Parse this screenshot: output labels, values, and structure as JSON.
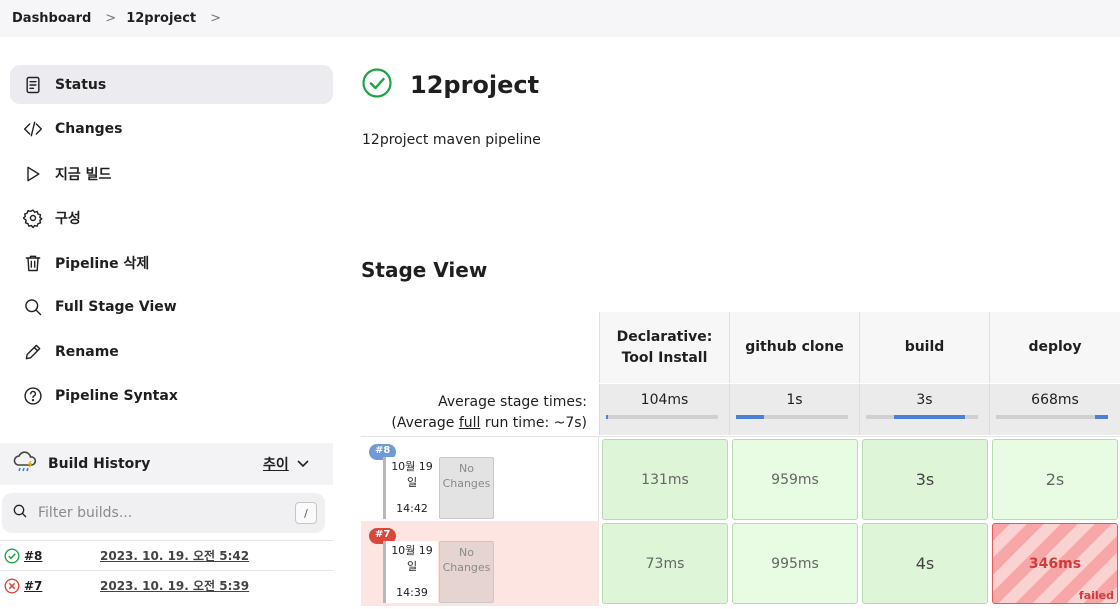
{
  "breadcrumb": {
    "items": [
      "Dashboard",
      "12project"
    ]
  },
  "sidebar": {
    "tasks": [
      {
        "label": "Status",
        "icon": "document-icon"
      },
      {
        "label": "Changes",
        "icon": "code-icon"
      },
      {
        "label": "지금 빌드",
        "icon": "play-icon"
      },
      {
        "label": "구성",
        "icon": "gear-icon"
      },
      {
        "label": "Pipeline 삭제",
        "icon": "trash-icon"
      },
      {
        "label": "Full Stage View",
        "icon": "search-icon"
      },
      {
        "label": "Rename",
        "icon": "pencil-icon"
      },
      {
        "label": "Pipeline Syntax",
        "icon": "help-icon"
      }
    ]
  },
  "build_history": {
    "title": "Build History",
    "trend_label": "추이",
    "filter_placeholder": "Filter builds...",
    "filter_shortcut": "/",
    "builds": [
      {
        "number": "#8",
        "date": "2023. 10. 19. 오전 5:42",
        "status": "success"
      },
      {
        "number": "#7",
        "date": "2023. 10. 19. 오전 5:39",
        "status": "failed"
      }
    ]
  },
  "project": {
    "name": "12project",
    "description": "12project maven pipeline"
  },
  "stage_view": {
    "title": "Stage View",
    "avg_label_line1": "Average stage times:",
    "avg_label_line2_prefix": "(Average ",
    "avg_label_line2_link": "full",
    "avg_label_line2_suffix": " run time: ~7s)",
    "stages": [
      {
        "name_line1": "Declarative:",
        "name_line2": "Tool Install",
        "avg": "104ms",
        "bar_start": 0.0,
        "bar_end": 0.02
      },
      {
        "name_line1": "github clone",
        "name_line2": "",
        "avg": "1s",
        "bar_start": 0.0,
        "bar_end": 0.25
      },
      {
        "name_line1": "build",
        "name_line2": "",
        "avg": "3s",
        "bar_start": 0.25,
        "bar_end": 0.88
      },
      {
        "name_line1": "deploy",
        "name_line2": "",
        "avg": "668ms",
        "bar_start": 0.88,
        "bar_end": 1.0
      }
    ],
    "runs": [
      {
        "badge": "#8",
        "date_line1": "10월 19",
        "date_line2": "일",
        "time": "14:42",
        "changes_line1": "No",
        "changes_line2": "Changes",
        "status": "success",
        "durations": [
          "131ms",
          "959ms",
          "3s",
          "2s"
        ]
      },
      {
        "badge": "#7",
        "date_line1": "10월 19",
        "date_line2": "일",
        "time": "14:39",
        "changes_line1": "No",
        "changes_line2": "Changes",
        "status": "failed",
        "durations": [
          "73ms",
          "995ms",
          "4s",
          "346ms"
        ],
        "failed_stage": 3,
        "failed_label": "failed"
      }
    ]
  },
  "colors": {
    "success_green": "#1ea446",
    "failed_red": "#e0453a",
    "cell_green": "#dff5d8",
    "cell_green_light": "#e8fbe3",
    "row_failed_bg": "#fde5e2",
    "bar_blue": "#4a80d8"
  }
}
